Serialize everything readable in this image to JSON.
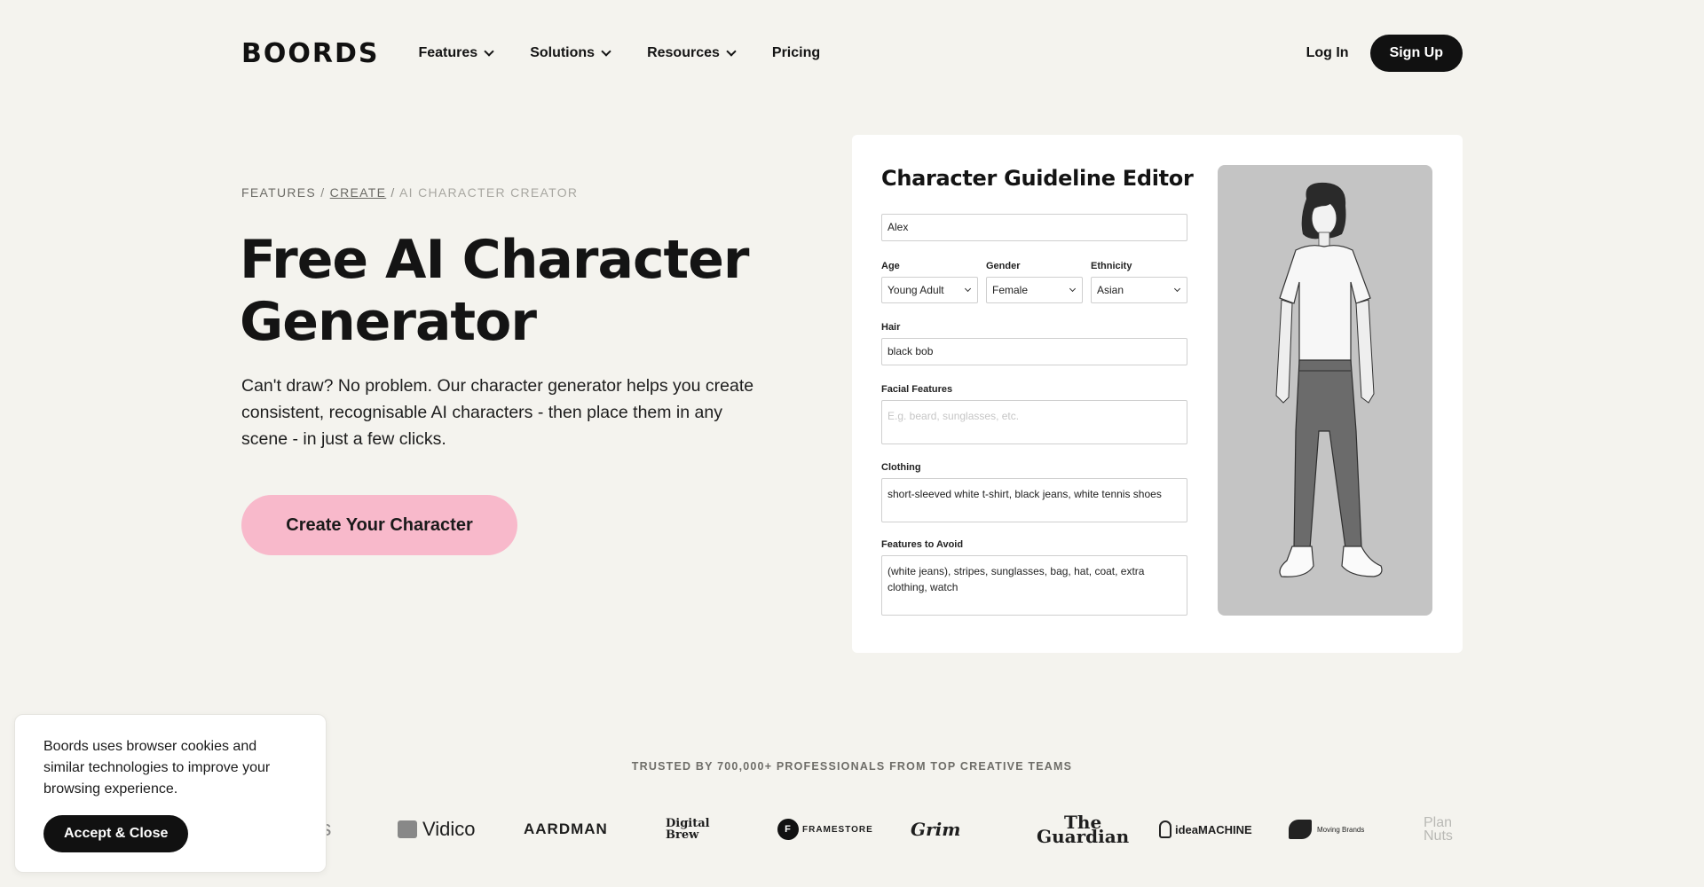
{
  "nav": {
    "logo": "BOORDS",
    "items": [
      {
        "label": "Features",
        "has_dropdown": true
      },
      {
        "label": "Solutions",
        "has_dropdown": true
      },
      {
        "label": "Resources",
        "has_dropdown": true
      },
      {
        "label": "Pricing",
        "has_dropdown": false
      }
    ],
    "login": "Log In",
    "signup": "Sign Up"
  },
  "breadcrumb": {
    "features": "Features",
    "create": "Create",
    "current": "AI Character Creator",
    "sep": "/"
  },
  "hero": {
    "title_line1": "Free AI Character",
    "title_line2": "Generator",
    "subtitle": "Can't draw? No problem. Our character generator helps you create consistent, recognisable AI characters - then place them in any scene - in just a few clicks.",
    "cta": "Create Your Character"
  },
  "editor": {
    "title": "Character Guideline Editor",
    "name_value": "Alex",
    "age_label": "Age",
    "age_value": "Young Adult",
    "gender_label": "Gender",
    "gender_value": "Female",
    "ethnicity_label": "Ethnicity",
    "ethnicity_value": "Asian",
    "hair_label": "Hair",
    "hair_value": "black bob",
    "facial_label": "Facial Features",
    "facial_placeholder": "E.g. beard, sunglasses, etc.",
    "clothing_label": "Clothing",
    "clothing_value": "short-sleeved white t-shirt, black jeans, white tennis shoes",
    "avoid_label": "Features to Avoid",
    "avoid_value": "(white jeans), stripes, sunglasses, bag, hat, coat, extra clothing, watch"
  },
  "trusted": {
    "heading": "Trusted by 700,000+ professionals from top creative teams",
    "brands": [
      "is",
      "Vidico",
      "AARDMAN",
      "Digital Brew",
      "FRAMESTORE",
      "Grim",
      "The Guardian",
      "ideaMACHINE",
      "Moving Brands",
      "Plan Nuts"
    ]
  },
  "cookie": {
    "text": "Boords uses browser cookies and similar technologies to improve your browsing experience.",
    "button": "Accept & Close"
  },
  "colors": {
    "background": "#f4f3ee",
    "cta_pink": "#f8b9cb",
    "dark": "#111111",
    "character_panel": "#c4c4c4"
  }
}
